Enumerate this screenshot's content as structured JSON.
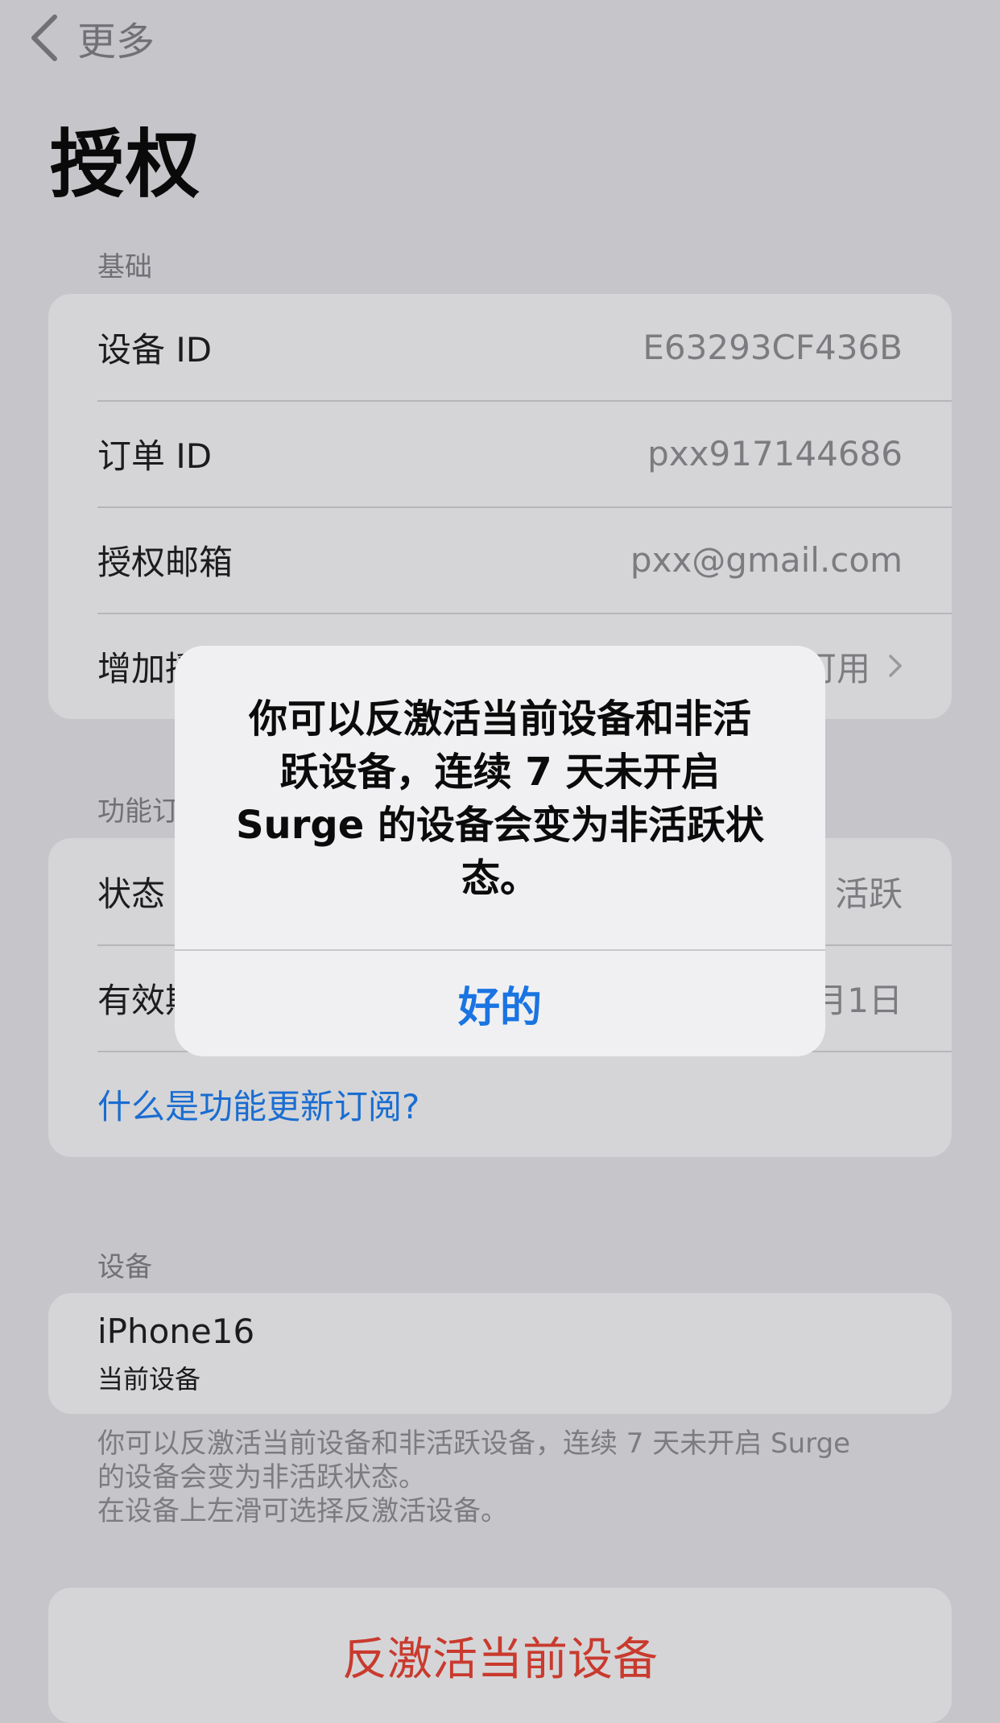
{
  "nav": {
    "back_label": "更多"
  },
  "title": "授权",
  "sections": {
    "basic": {
      "header": "基础",
      "rows": [
        {
          "label": "设备 ID",
          "value": "E63293CF436B"
        },
        {
          "label": "订单 ID",
          "value": "pxx917144686"
        },
        {
          "label": "授权邮箱",
          "value": "pxx@gmail.com"
        },
        {
          "label": "增加授",
          "value": "可用"
        }
      ]
    },
    "feature": {
      "header": "功能订",
      "rows": [
        {
          "label": "状态",
          "value": "活跃"
        },
        {
          "label": "有效期",
          "value": "月1日"
        }
      ],
      "link": "什么是功能更新订阅?"
    },
    "devices": {
      "header": "设备",
      "device_name": "iPhone16",
      "device_sub": "当前设备",
      "footnote": [
        "你可以反激活当前设备和非活跃设备，连续 7 天未开启 Surge",
        "的设备会变为非活跃状态。",
        "在设备上左滑可选择反激活设备。"
      ]
    },
    "deactivate": {
      "label": "反激活当前设备"
    }
  },
  "alert": {
    "lines": [
      "你可以反激活当前设备和非活",
      "跃设备，连续 7 天未开启",
      "Surge 的设备会变为非活跃状",
      "态。"
    ],
    "ok_label": "好的"
  },
  "icons": {
    "back": "chevron-left-icon",
    "disclosure": "chevron-right-icon"
  },
  "colors": {
    "link": "#1a6dd1",
    "destructive": "#c93a2e",
    "alert_button": "#1a74e2"
  }
}
